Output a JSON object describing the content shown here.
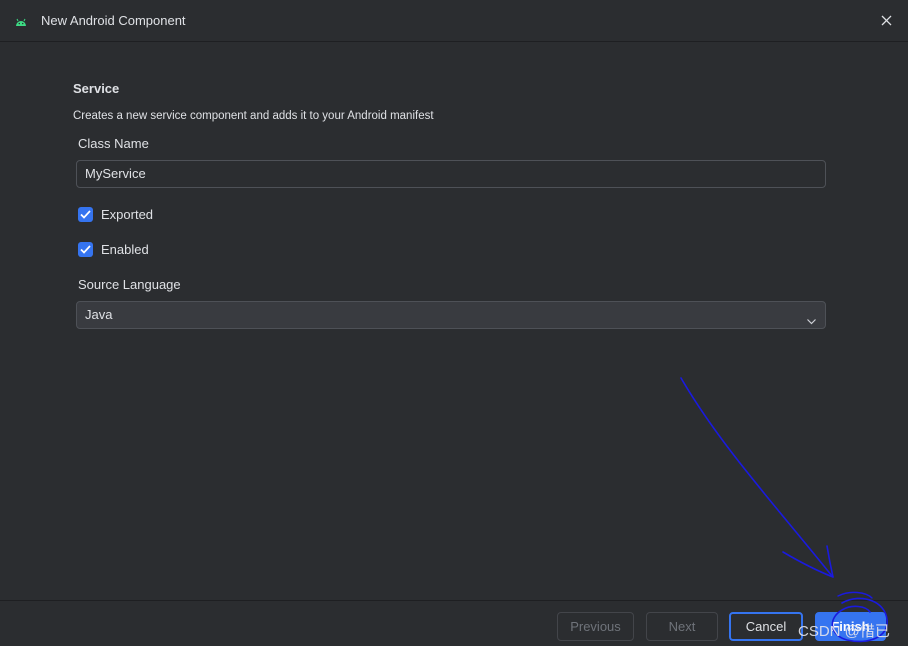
{
  "window": {
    "title": "New Android Component",
    "app_icon": "android-icon",
    "close_icon": "close-icon"
  },
  "form": {
    "section_title": "Service",
    "section_description": "Creates a new service component and adds it to your Android manifest",
    "class_name": {
      "label": "Class Name",
      "value": "MyService"
    },
    "exported": {
      "label": "Exported",
      "checked": true
    },
    "enabled": {
      "label": "Enabled",
      "checked": true
    },
    "source_language": {
      "label": "Source Language",
      "selected": "Java",
      "icon": "chevron-down-icon"
    }
  },
  "footer": {
    "previous_label": "Previous",
    "next_label": "Next",
    "cancel_label": "Cancel",
    "finish_label": "Finish"
  },
  "watermark": "CSDN @惜已",
  "colors": {
    "background": "#2b2d30",
    "accent": "#3574f0",
    "android_green": "#3ddc84",
    "annotation_ink": "#1a1adf"
  }
}
